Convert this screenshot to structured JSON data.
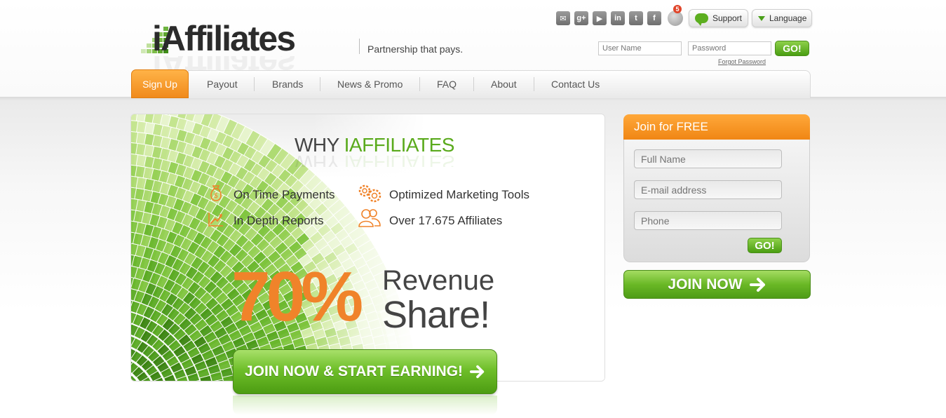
{
  "brand": {
    "logo_text": "iAffiliates",
    "tagline": "Partnership that pays."
  },
  "header": {
    "social_icons": [
      "email-icon",
      "google-plus-icon",
      "youtube-icon",
      "linkedin-icon",
      "twitter-icon",
      "facebook-icon"
    ],
    "social_glyphs": [
      "✉",
      "g+",
      "▶",
      "in",
      "t",
      "f"
    ],
    "notification_count": "5",
    "support_label": "Support",
    "language_label": "Language"
  },
  "login": {
    "username_placeholder": "User Name",
    "password_placeholder": "Password",
    "go_label": "GO!",
    "forgot_label": "Forgot Password"
  },
  "nav": {
    "signup": "Sign Up",
    "items": [
      "Payout",
      "Brands",
      "News & Promo",
      "FAQ",
      "About",
      "Contact Us"
    ]
  },
  "hero": {
    "why_prefix": "WHY ",
    "why_highlight": "IAFFILIATES",
    "features": [
      "On Time Payments",
      "Optimized Marketing Tools",
      "In Depth Reports",
      "Over 17.675 Affiliates"
    ],
    "percent": "70%",
    "revenue_line1": "Revenue",
    "revenue_line2": "Share!",
    "cta_label": "JOIN NOW & START EARNING!"
  },
  "join": {
    "title": "Join for FREE",
    "full_name_placeholder": "Full Name",
    "email_placeholder": "E-mail address",
    "phone_placeholder": "Phone",
    "go_label": "GO!",
    "join_now_label": "JOIN NOW"
  },
  "colors": {
    "accent_orange": "#f08614",
    "accent_green": "#5aaa1c",
    "text_dark": "#444444"
  }
}
